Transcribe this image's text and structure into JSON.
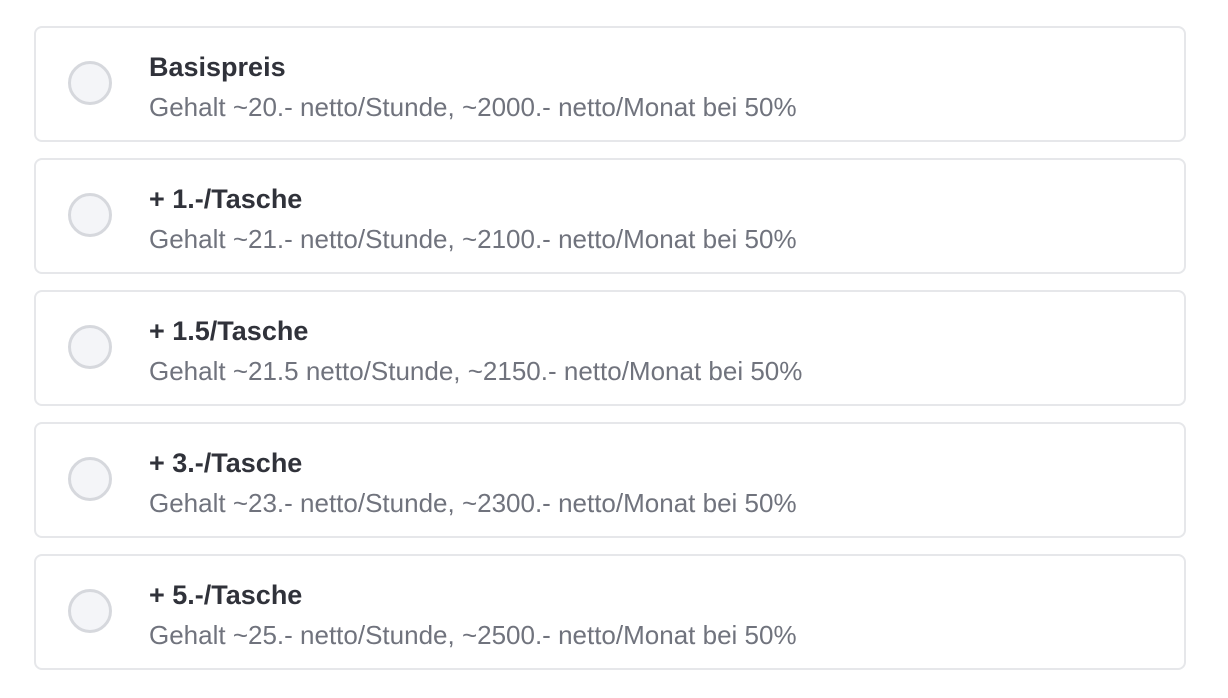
{
  "options": [
    {
      "title": "Basispreis",
      "description": "Gehalt ~20.- netto/Stunde, ~2000.- netto/Monat bei 50%",
      "selected": false
    },
    {
      "title": "+ 1.-/Tasche",
      "description": "Gehalt ~21.- netto/Stunde, ~2100.- netto/Monat bei 50%",
      "selected": false
    },
    {
      "title": "+ 1.5/Tasche",
      "description": "Gehalt ~21.5 netto/Stunde, ~2150.- netto/Monat bei 50%",
      "selected": false
    },
    {
      "title": "+ 3.-/Tasche",
      "description": "Gehalt ~23.- netto/Stunde, ~2300.- netto/Monat bei 50%",
      "selected": false
    },
    {
      "title": "+ 5.-/Tasche",
      "description": "Gehalt ~25.- netto/Stunde, ~2500.- netto/Monat bei 50%",
      "selected": false
    }
  ],
  "colors": {
    "border": "#e6e7ea",
    "radio_border": "#d6d8dd",
    "radio_fill": "#f4f5f8",
    "title": "#30323a",
    "description": "#70737d"
  }
}
